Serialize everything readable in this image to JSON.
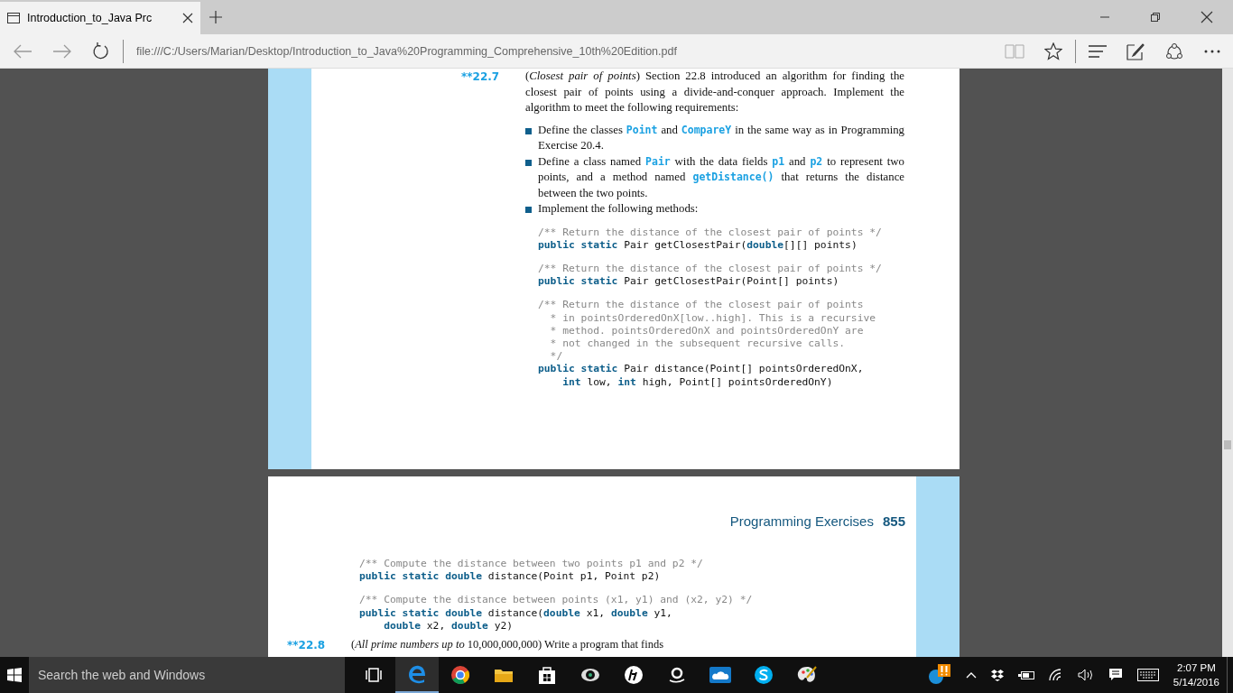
{
  "browser": {
    "tabs": [
      {
        "title": "Introduction_to_Java Prc",
        "selected": true
      }
    ],
    "address": "file:///C:/Users/Marian/Desktop/Introduction_to_Java%20Programming_Comprehensive_10th%20Edition.pdf"
  },
  "page_1": {
    "exercise_number": "**22.7",
    "intro": "(*Closest pair of points*) Section 22.8 introduced an algorithm for finding the closest pair of points using a divide-and-conquer approach. Implement the algorithm to meet the following requirements:",
    "bullets": [
      [
        {
          "kind": "text",
          "text": "Define the classes "
        },
        {
          "kind": "code",
          "text": "Point"
        },
        {
          "kind": "text",
          "text": " and "
        },
        {
          "kind": "code",
          "text": "CompareY"
        },
        {
          "kind": "text",
          "text": " in the same way as in Programming Exercise 20.4."
        }
      ],
      [
        {
          "kind": "text",
          "text": "Define a class named "
        },
        {
          "kind": "code",
          "text": "Pair"
        },
        {
          "kind": "text",
          "text": " with the data fields "
        },
        {
          "kind": "code",
          "text": "p1"
        },
        {
          "kind": "text",
          "text": " and "
        },
        {
          "kind": "code",
          "text": "p2"
        },
        {
          "kind": "text",
          "text": " to represent two points, and a method named "
        },
        {
          "kind": "code",
          "text": "getDistance()"
        },
        {
          "kind": "text",
          "text": " that returns the distance between the two points."
        }
      ],
      [
        {
          "kind": "text",
          "text": "Implement the following methods:"
        }
      ]
    ],
    "code_blocks": [
      [
        [
          {
            "kind": "comment",
            "text": "/** Return the distance of the closest pair of points */"
          }
        ],
        [
          {
            "kind": "keyword",
            "text": "public static"
          },
          {
            "kind": "plain",
            "text": " Pair getClosestPair("
          },
          {
            "kind": "keyword",
            "text": "double"
          },
          {
            "kind": "plain",
            "text": "[][] points)"
          }
        ]
      ],
      [
        [
          {
            "kind": "comment",
            "text": "/** Return the distance of the closest pair of points */"
          }
        ],
        [
          {
            "kind": "keyword",
            "text": "public static"
          },
          {
            "kind": "plain",
            "text": " Pair getClosestPair(Point[] points)"
          }
        ]
      ],
      [
        [
          {
            "kind": "comment",
            "text": "/** Return the distance of the closest pair of points"
          }
        ],
        [
          {
            "kind": "comment",
            "text": "  * in pointsOrderedOnX[low..high]. This is a recursive"
          }
        ],
        [
          {
            "kind": "comment",
            "text": "  * method. pointsOrderedOnX and pointsOrderedOnY are"
          }
        ],
        [
          {
            "kind": "comment",
            "text": "  * not changed in the subsequent recursive calls."
          }
        ],
        [
          {
            "kind": "comment",
            "text": "  */"
          }
        ],
        [
          {
            "kind": "keyword",
            "text": "public static"
          },
          {
            "kind": "plain",
            "text": " Pair distance(Point[] pointsOrderedOnX,"
          }
        ],
        [
          {
            "kind": "indent"
          },
          {
            "kind": "keyword",
            "text": "int"
          },
          {
            "kind": "plain",
            "text": " low, "
          },
          {
            "kind": "keyword",
            "text": "int"
          },
          {
            "kind": "plain",
            "text": " high, Point[] pointsOrderedOnY)"
          }
        ]
      ]
    ]
  },
  "page_2": {
    "header_title": "Programming Exercises",
    "page_number": "855",
    "code_blocks": [
      [
        [
          {
            "kind": "comment",
            "text": "/** Compute the distance between two points p1 and p2 */"
          }
        ],
        [
          {
            "kind": "keyword",
            "text": "public static double"
          },
          {
            "kind": "plain",
            "text": " distance(Point p1, Point p2)"
          }
        ]
      ],
      [
        [
          {
            "kind": "comment",
            "text": "/** Compute the distance between points (x1, y1) and (x2, y2) */"
          }
        ],
        [
          {
            "kind": "keyword",
            "text": "public static double"
          },
          {
            "kind": "plain",
            "text": " distance("
          },
          {
            "kind": "keyword",
            "text": "double"
          },
          {
            "kind": "plain",
            "text": " x1, "
          },
          {
            "kind": "keyword",
            "text": "double"
          },
          {
            "kind": "plain",
            "text": " y1,"
          }
        ],
        [
          {
            "kind": "indent"
          },
          {
            "kind": "keyword",
            "text": "double"
          },
          {
            "kind": "plain",
            "text": " x2, "
          },
          {
            "kind": "keyword",
            "text": "double"
          },
          {
            "kind": "plain",
            "text": " y2)"
          }
        ]
      ]
    ],
    "next_exercise_number": "**22.8",
    "next_exercise_text": "(*All prime numbers up to* 10,000,000,000) Write a program that finds"
  },
  "taskbar": {
    "search_placeholder": "Search the web and Windows",
    "apps": [
      {
        "kind": "task-view",
        "selected": false
      },
      {
        "kind": "edge",
        "selected": true
      },
      {
        "kind": "chrome",
        "selected": false
      },
      {
        "kind": "folder",
        "selected": false
      },
      {
        "kind": "store",
        "selected": false
      },
      {
        "kind": "camera",
        "selected": false
      },
      {
        "kind": "hp",
        "selected": false
      },
      {
        "kind": "amazon",
        "selected": false
      },
      {
        "kind": "cloud",
        "selected": false
      },
      {
        "kind": "skype",
        "selected": false
      },
      {
        "kind": "paint",
        "selected": false
      }
    ],
    "time": "2:07 PM",
    "date": "5/14/2016"
  }
}
